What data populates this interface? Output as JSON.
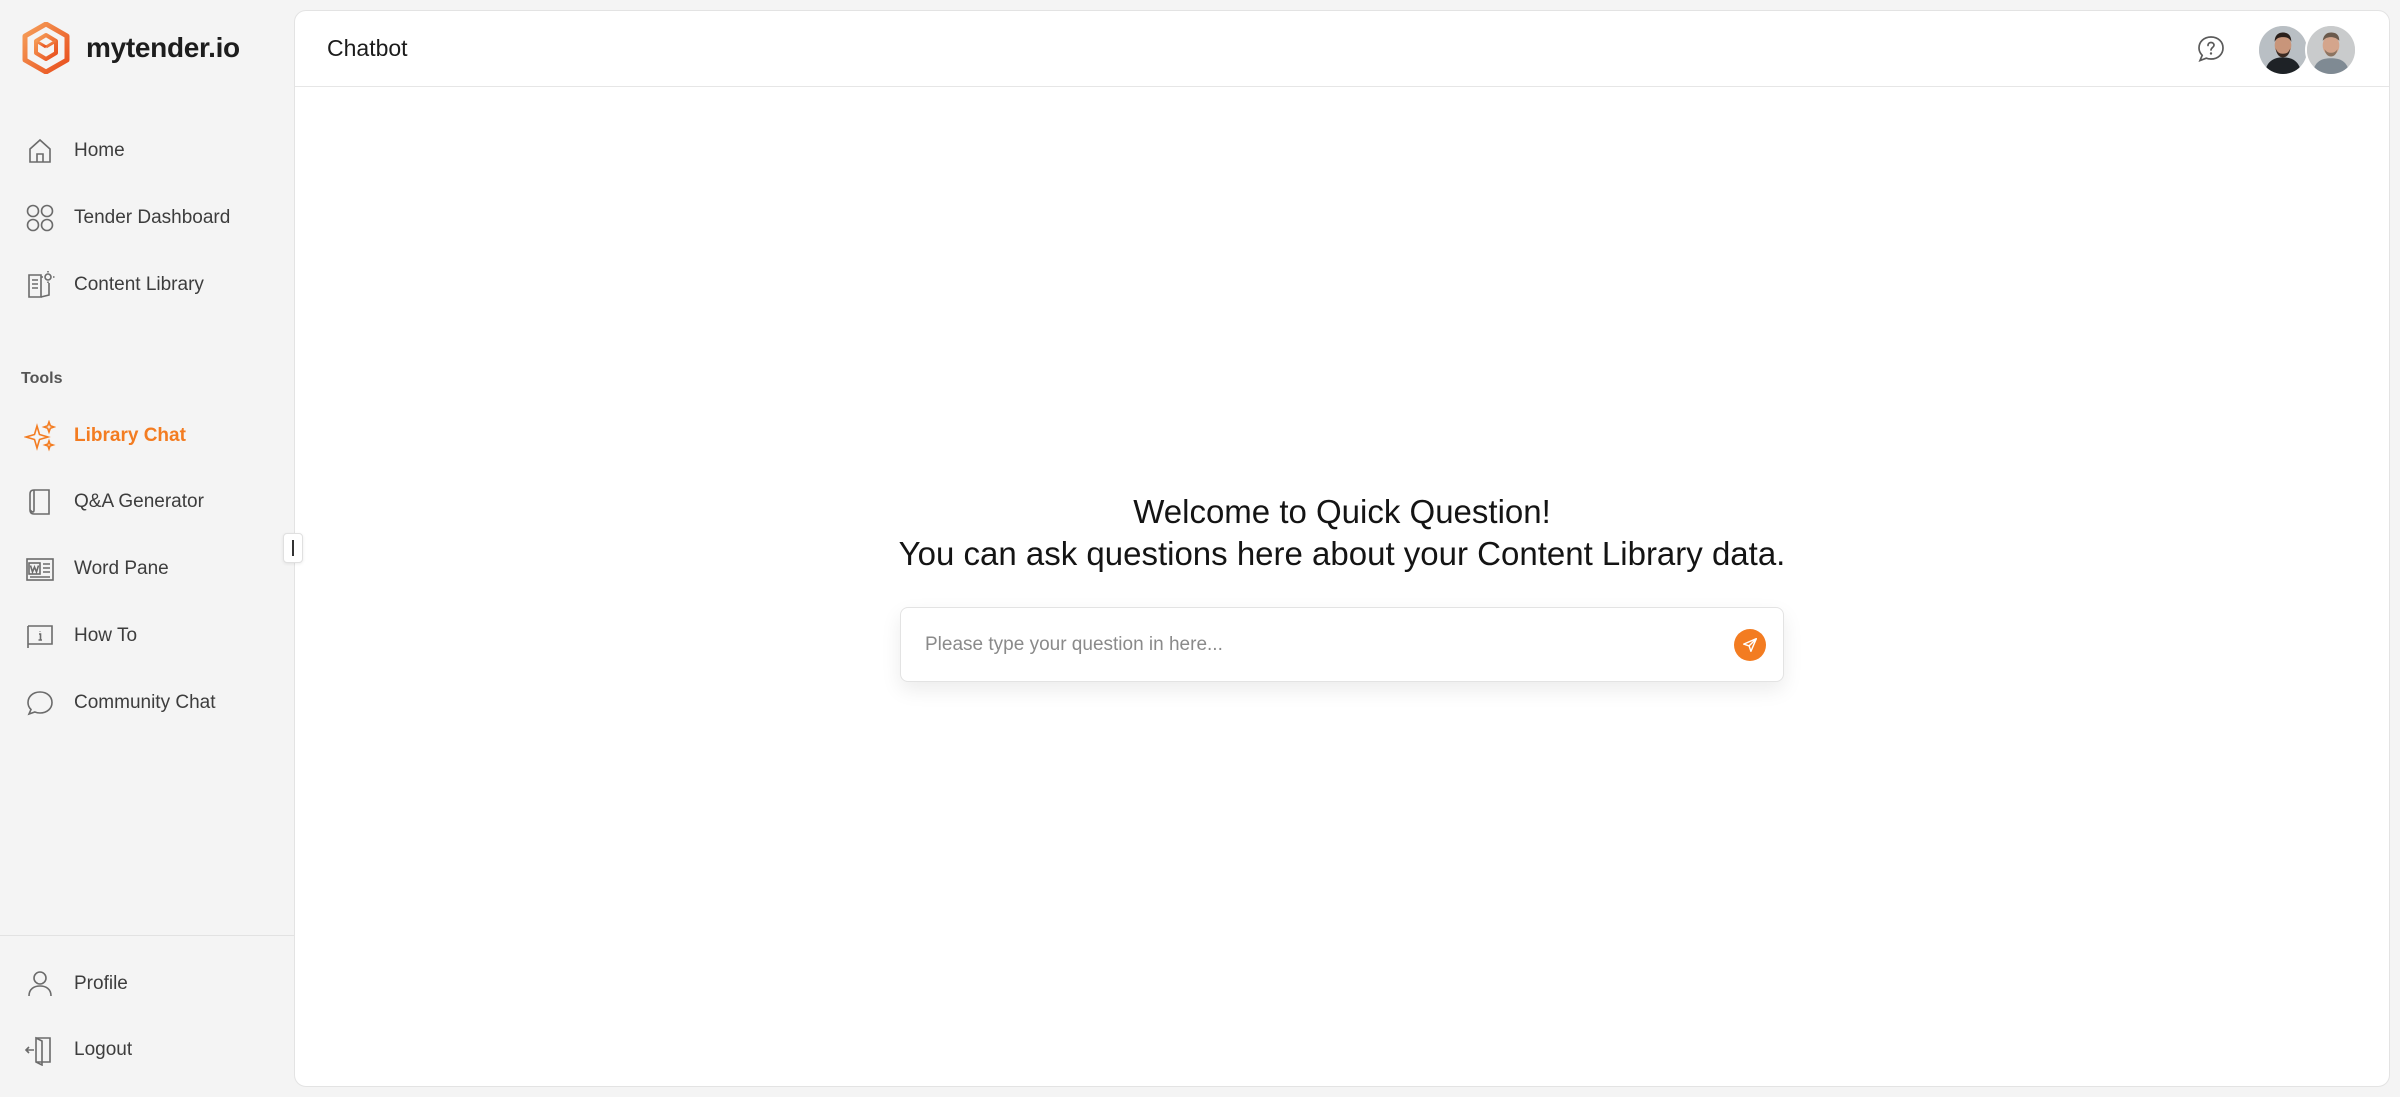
{
  "brand": {
    "name": "mytender.io",
    "accent_color": "#f37c21"
  },
  "sidebar": {
    "main_items": [
      {
        "label": "Home",
        "icon": "home-icon"
      },
      {
        "label": "Tender Dashboard",
        "icon": "dashboard-icon"
      },
      {
        "label": "Content Library",
        "icon": "library-icon"
      }
    ],
    "tools_label": "Tools",
    "tool_items": [
      {
        "label": "Library Chat",
        "icon": "sparkle-icon",
        "active": true
      },
      {
        "label": "Q&A Generator",
        "icon": "document-icon"
      },
      {
        "label": "Word Pane",
        "icon": "word-icon"
      },
      {
        "label": "How To",
        "icon": "info-book-icon"
      },
      {
        "label": "Community Chat",
        "icon": "chat-bubble-icon"
      }
    ],
    "bottom_items": [
      {
        "label": "Profile",
        "icon": "user-icon"
      },
      {
        "label": "Logout",
        "icon": "logout-icon"
      }
    ]
  },
  "header": {
    "title": "Chatbot"
  },
  "main": {
    "welcome_line1": "Welcome to Quick Question!",
    "welcome_line2": "You can ask questions here about your Content Library data.",
    "input_placeholder": "Please type your question in here..."
  }
}
